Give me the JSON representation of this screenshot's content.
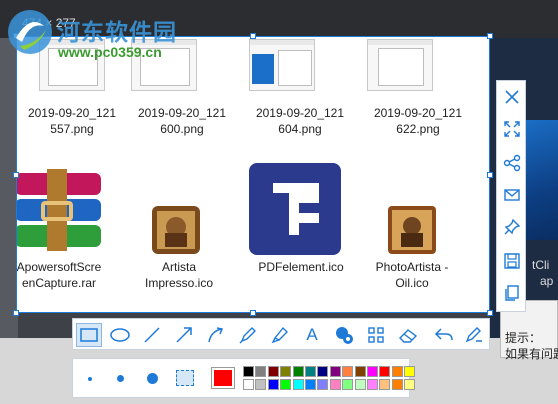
{
  "background": {
    "dialog_lines": [
      "提示：",
      "如果有问题"
    ],
    "right_partial_labels": [
      "tCli",
      "ap"
    ]
  },
  "selection": {
    "size_label": "474 × 277"
  },
  "watermark": {
    "site_name": "河东软件园",
    "url": "www.pc0359.cn"
  },
  "files": [
    {
      "name_line1": "2019-09-20_121",
      "name_line2": "557.png",
      "kind": "png"
    },
    {
      "name_line1": "2019-09-20_121",
      "name_line2": "600.png",
      "kind": "png"
    },
    {
      "name_line1": "2019-09-20_121",
      "name_line2": "604.png",
      "kind": "png"
    },
    {
      "name_line1": "2019-09-20_121",
      "name_line2": "622.png",
      "kind": "png"
    },
    {
      "name_line1": "ApowersoftScre",
      "name_line2": "enCapture.rar",
      "kind": "rar"
    },
    {
      "name_line1": "Artista",
      "name_line2": "Impresso.ico",
      "kind": "ico"
    },
    {
      "name_line1": "PDFelement.ico",
      "name_line2": "",
      "kind": "ico"
    },
    {
      "name_line1": "PhotoArtista -",
      "name_line2": "Oil.ico",
      "kind": "ico"
    }
  ],
  "side_toolbar": [
    {
      "name": "close",
      "icon": "close-icon"
    },
    {
      "name": "fullscreen",
      "icon": "expand-icon"
    },
    {
      "name": "share",
      "icon": "share-icon"
    },
    {
      "name": "email",
      "icon": "mail-icon"
    },
    {
      "name": "pin",
      "icon": "pin-icon"
    },
    {
      "name": "save",
      "icon": "save-icon"
    },
    {
      "name": "copy",
      "icon": "copy-icon"
    }
  ],
  "toolbar": [
    {
      "name": "rectangle",
      "icon": "rectangle-icon",
      "selected": true
    },
    {
      "name": "ellipse",
      "icon": "ellipse-icon"
    },
    {
      "name": "line",
      "icon": "line-icon"
    },
    {
      "name": "arrow",
      "icon": "arrow-icon"
    },
    {
      "name": "curved-arrow",
      "icon": "curved-arrow-icon"
    },
    {
      "name": "pen",
      "icon": "pen-icon"
    },
    {
      "name": "highlighter",
      "icon": "highlighter-icon"
    },
    {
      "name": "text",
      "icon": "text-icon",
      "label": "A"
    },
    {
      "name": "number",
      "icon": "number-icon"
    },
    {
      "name": "mosaic",
      "icon": "mosaic-icon"
    },
    {
      "name": "eraser",
      "icon": "eraser-icon"
    },
    {
      "name": "undo",
      "icon": "undo-icon"
    },
    {
      "name": "edit",
      "icon": "edit-icon"
    }
  ],
  "brush_sizes": [
    "small",
    "medium",
    "large",
    "blur"
  ],
  "current_color": "#ff0000",
  "palette_row1": [
    "#000000",
    "#808080",
    "#800000",
    "#808000",
    "#008000",
    "#008080",
    "#000080",
    "#800080",
    "#ff8040",
    "#804000",
    "#ff00ff",
    "#ff0000",
    "#ff8000",
    "#ffff00"
  ],
  "palette_row2": [
    "#ffffff",
    "#c0c0c0",
    "#0000ff",
    "#00ff00",
    "#00ffff",
    "#0080ff",
    "#8080ff",
    "#ff80c0",
    "#80ff80",
    "#c0ffc0",
    "#ff80ff",
    "#ffc080",
    "#ff8000",
    "#ffff80"
  ]
}
